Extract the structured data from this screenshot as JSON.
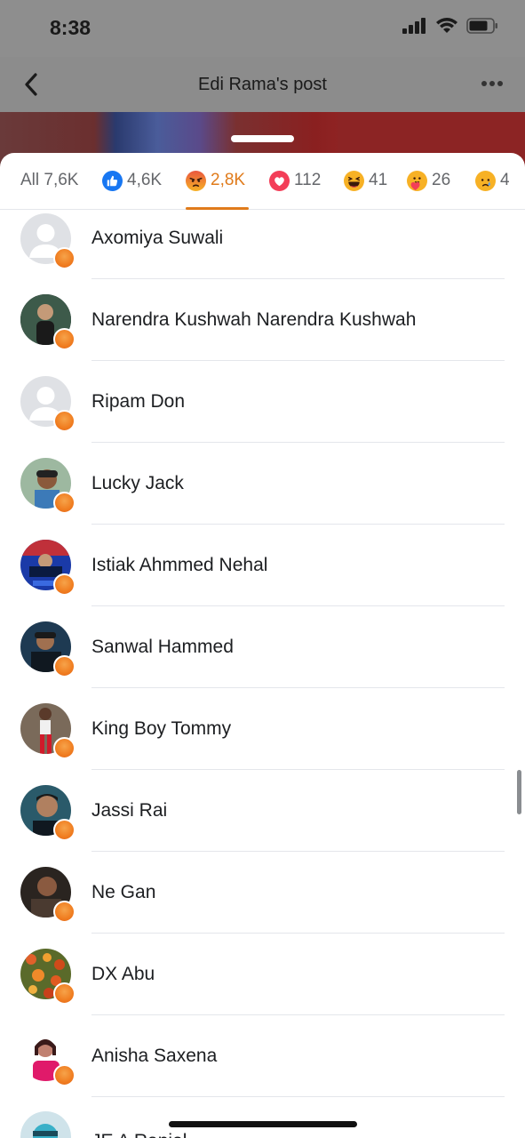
{
  "status_bar": {
    "time": "8:38"
  },
  "nav": {
    "title": "Edi Rama's post"
  },
  "tabs": [
    {
      "label": "All 7,6K",
      "reaction": "all"
    },
    {
      "label": "4,6K",
      "reaction": "like",
      "icon": "like-icon",
      "color": "#1877f2"
    },
    {
      "label": "2,8K",
      "reaction": "angry",
      "icon": "angry-icon",
      "color": "#f07d20",
      "active": true
    },
    {
      "label": "112",
      "reaction": "love",
      "icon": "love-icon",
      "color": "#f33e58"
    },
    {
      "label": "41",
      "reaction": "haha",
      "icon": "haha-icon",
      "color": "#f7b125"
    },
    {
      "label": "26",
      "reaction": "care",
      "icon": "care-icon",
      "color": "#f7b125"
    },
    {
      "label": "4",
      "reaction": "sad",
      "icon": "sad-icon",
      "color": "#f7b125"
    }
  ],
  "accent_color": "#e07b1b",
  "people": [
    {
      "name": "Axomiya Suwali",
      "avatar": "default"
    },
    {
      "name": "Narendra Kushwah Narendra Kushwah",
      "avatar": "photo"
    },
    {
      "name": "Ripam Don",
      "avatar": "default"
    },
    {
      "name": "Lucky Jack",
      "avatar": "photo"
    },
    {
      "name": "Istiak Ahmmed Nehal",
      "avatar": "photo"
    },
    {
      "name": "Sanwal Hammed",
      "avatar": "photo"
    },
    {
      "name": "King Boy Tommy",
      "avatar": "photo"
    },
    {
      "name": "Jassi Rai",
      "avatar": "photo"
    },
    {
      "name": "Ne Gan",
      "avatar": "photo"
    },
    {
      "name": "DX Abu",
      "avatar": "photo"
    },
    {
      "name": "Anisha Saxena",
      "avatar": "photo"
    },
    {
      "name": "JE A Raniel",
      "avatar": "photo"
    }
  ]
}
